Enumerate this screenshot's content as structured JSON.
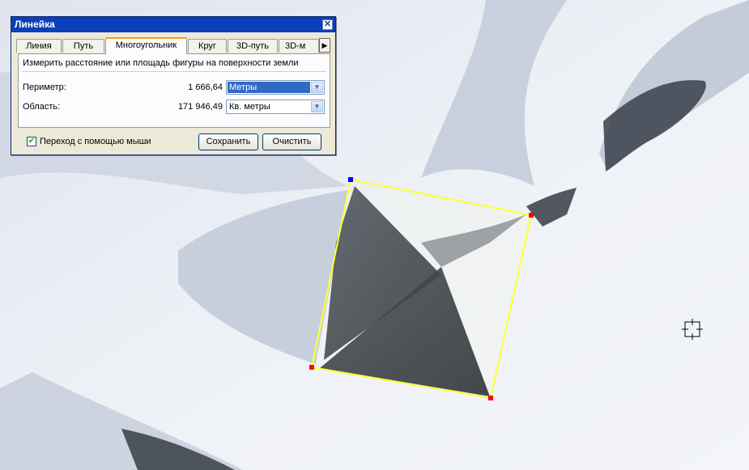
{
  "dialog": {
    "title": "Линейка",
    "tabs": [
      {
        "label": "Линия"
      },
      {
        "label": "Путь"
      },
      {
        "label": "Многоугольник",
        "active": true
      },
      {
        "label": "Круг"
      },
      {
        "label": "3D-путь"
      },
      {
        "label": "3D-м"
      }
    ],
    "tab_scroll_icon": "arrow-right-icon",
    "description": "Измерить расстояние или площадь фигуры на поверхности земли",
    "perimeter": {
      "label": "Периметр:",
      "value": "1 666,64",
      "unit": "Метры"
    },
    "area": {
      "label": "Область:",
      "value": "171 946,49",
      "unit": "Кв. метры"
    },
    "mouse_nav": {
      "label": "Переход с помощью мыши",
      "checked": true
    },
    "save_label": "Сохранить",
    "clear_label": "Очистить",
    "close_icon": "close-icon"
  },
  "polygon": {
    "stroke_color": "#ffff33",
    "vertex_color": "#ff0000",
    "start_vertex_color": "#0000ff"
  },
  "colors": {
    "title_bar": "#0b3fb9",
    "dialog_bg": "#ece9d8"
  }
}
